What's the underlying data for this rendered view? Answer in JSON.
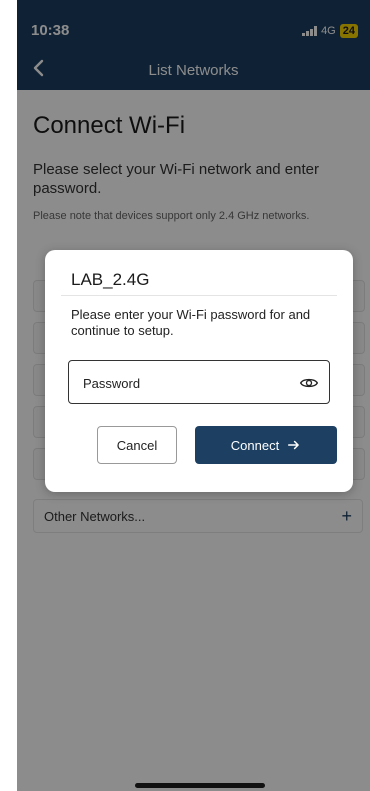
{
  "status_bar": {
    "time": "10:38",
    "network": "4G",
    "battery": "24"
  },
  "nav": {
    "title": "List Networks",
    "back_icon": "chevron-left-icon"
  },
  "page": {
    "title": "Connect Wi-Fi",
    "subtitle": "Please select your Wi-Fi network and enter password.",
    "note": "Please note that devices support only 2.4 GHz networks."
  },
  "other_networks": {
    "label": "Other Networks...",
    "icon": "plus-icon"
  },
  "modal": {
    "network_name": "LAB_2.4G",
    "message": "Please enter your Wi-Fi password for and continue to setup.",
    "password_placeholder": "Password",
    "password_value": "",
    "cancel_label": "Cancel",
    "connect_label": "Connect"
  },
  "colors": {
    "brand": "#1c3f62",
    "battery": "#f5d200"
  }
}
